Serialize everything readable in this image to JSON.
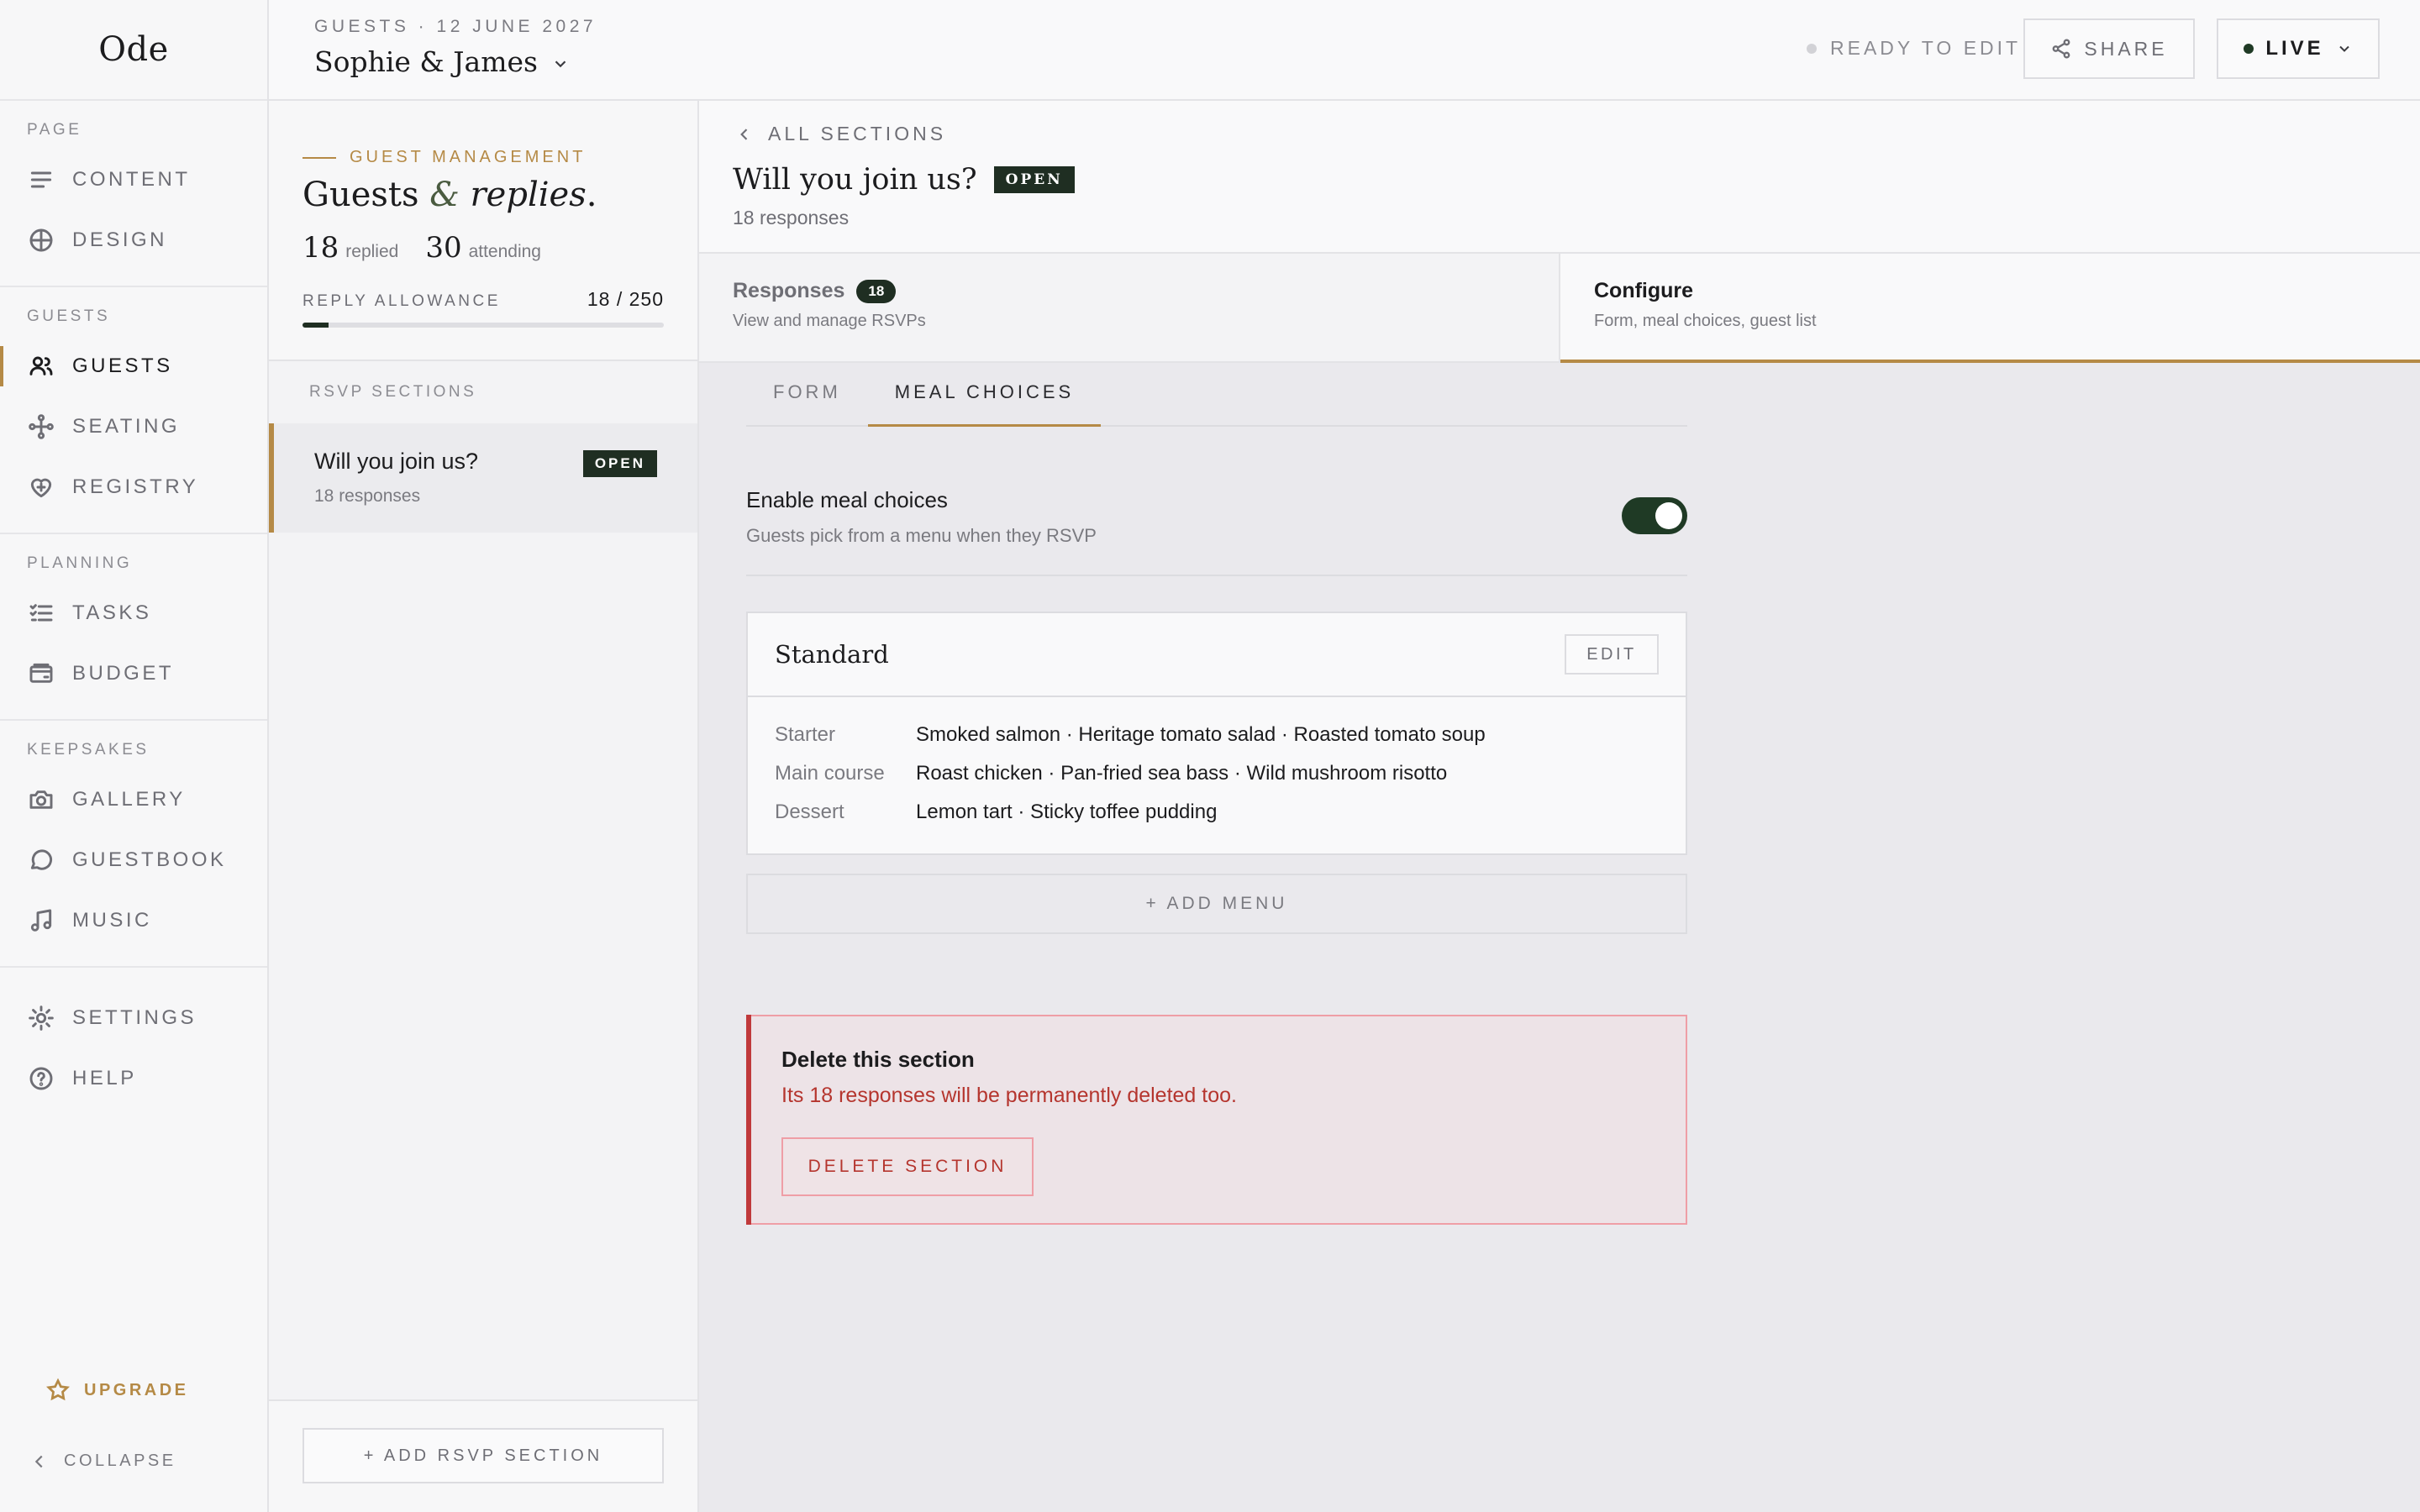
{
  "app": {
    "logo": "Ode"
  },
  "sidebar": {
    "groups": [
      {
        "title": "PAGE",
        "items": [
          {
            "label": "CONTENT",
            "icon": "lines-icon"
          },
          {
            "label": "DESIGN",
            "icon": "globe-icon"
          }
        ]
      },
      {
        "title": "GUESTS",
        "items": [
          {
            "label": "GUESTS",
            "icon": "users-icon",
            "active": true
          },
          {
            "label": "SEATING",
            "icon": "nodes-icon"
          },
          {
            "label": "REGISTRY",
            "icon": "heart-icon"
          }
        ]
      },
      {
        "title": "PLANNING",
        "items": [
          {
            "label": "TASKS",
            "icon": "checklist-icon"
          },
          {
            "label": "BUDGET",
            "icon": "wallet-icon"
          }
        ]
      },
      {
        "title": "KEEPSAKES",
        "items": [
          {
            "label": "GALLERY",
            "icon": "camera-icon"
          },
          {
            "label": "GUESTBOOK",
            "icon": "chat-icon"
          },
          {
            "label": "MUSIC",
            "icon": "music-icon"
          }
        ]
      },
      {
        "title": "",
        "items": [
          {
            "label": "SETTINGS",
            "icon": "sun-icon"
          },
          {
            "label": "HELP",
            "icon": "help-icon"
          }
        ]
      }
    ],
    "upgrade": "UPGRADE",
    "collapse": "COLLAPSE"
  },
  "header": {
    "breadcrumb": "GUESTS · 12 JUNE 2027",
    "couple": "Sophie & James",
    "status": "READY TO EDIT",
    "share": "SHARE",
    "live": "LIVE"
  },
  "panel": {
    "eyebrow": "GUEST MANAGEMENT",
    "title_a": "Guests ",
    "title_amp": "&",
    "title_b": " replies",
    "title_dot": ".",
    "replied_num": "18",
    "replied_label": "replied",
    "attending_num": "30",
    "attending_label": "attending",
    "allowance_label": "REPLY ALLOWANCE",
    "allowance_value": "18 / 250",
    "allowance_fraction": 0.072,
    "sections_label": "RSVP SECTIONS",
    "section": {
      "title": "Will you join us?",
      "badge": "OPEN",
      "sub": "18 responses"
    },
    "add_section": "+ ADD RSVP SECTION"
  },
  "main": {
    "back": "ALL SECTIONS",
    "title": "Will you join us?",
    "badge": "OPEN",
    "subtitle": "18 responses",
    "tabs": [
      {
        "title": "Responses",
        "count": "18",
        "desc": "View and manage RSVPs"
      },
      {
        "title": "Configure",
        "desc": "Form, meal choices, guest list"
      }
    ],
    "subtabs": [
      "FORM",
      "MEAL CHOICES"
    ],
    "toggle": {
      "title": "Enable meal choices",
      "desc": "Guests pick from a menu when they RSVP",
      "enabled": true
    },
    "menu": {
      "name": "Standard",
      "edit": "EDIT",
      "courses": [
        {
          "label": "Starter",
          "items": "Smoked salmon · Heritage tomato salad · Roasted tomato soup"
        },
        {
          "label": "Main course",
          "items": "Roast chicken · Pan-fried sea bass · Wild mushroom risotto"
        },
        {
          "label": "Dessert",
          "items": "Lemon tart · Sticky toffee pudding"
        }
      ]
    },
    "add_menu": "+ ADD MENU",
    "danger": {
      "title": "Delete this section",
      "desc": "Its 18 responses will be permanently deleted too.",
      "button": "DELETE SECTION"
    }
  },
  "colors": {
    "accent": "#b58a46",
    "dark_green": "#1f2e22",
    "danger": "#b5352e"
  }
}
